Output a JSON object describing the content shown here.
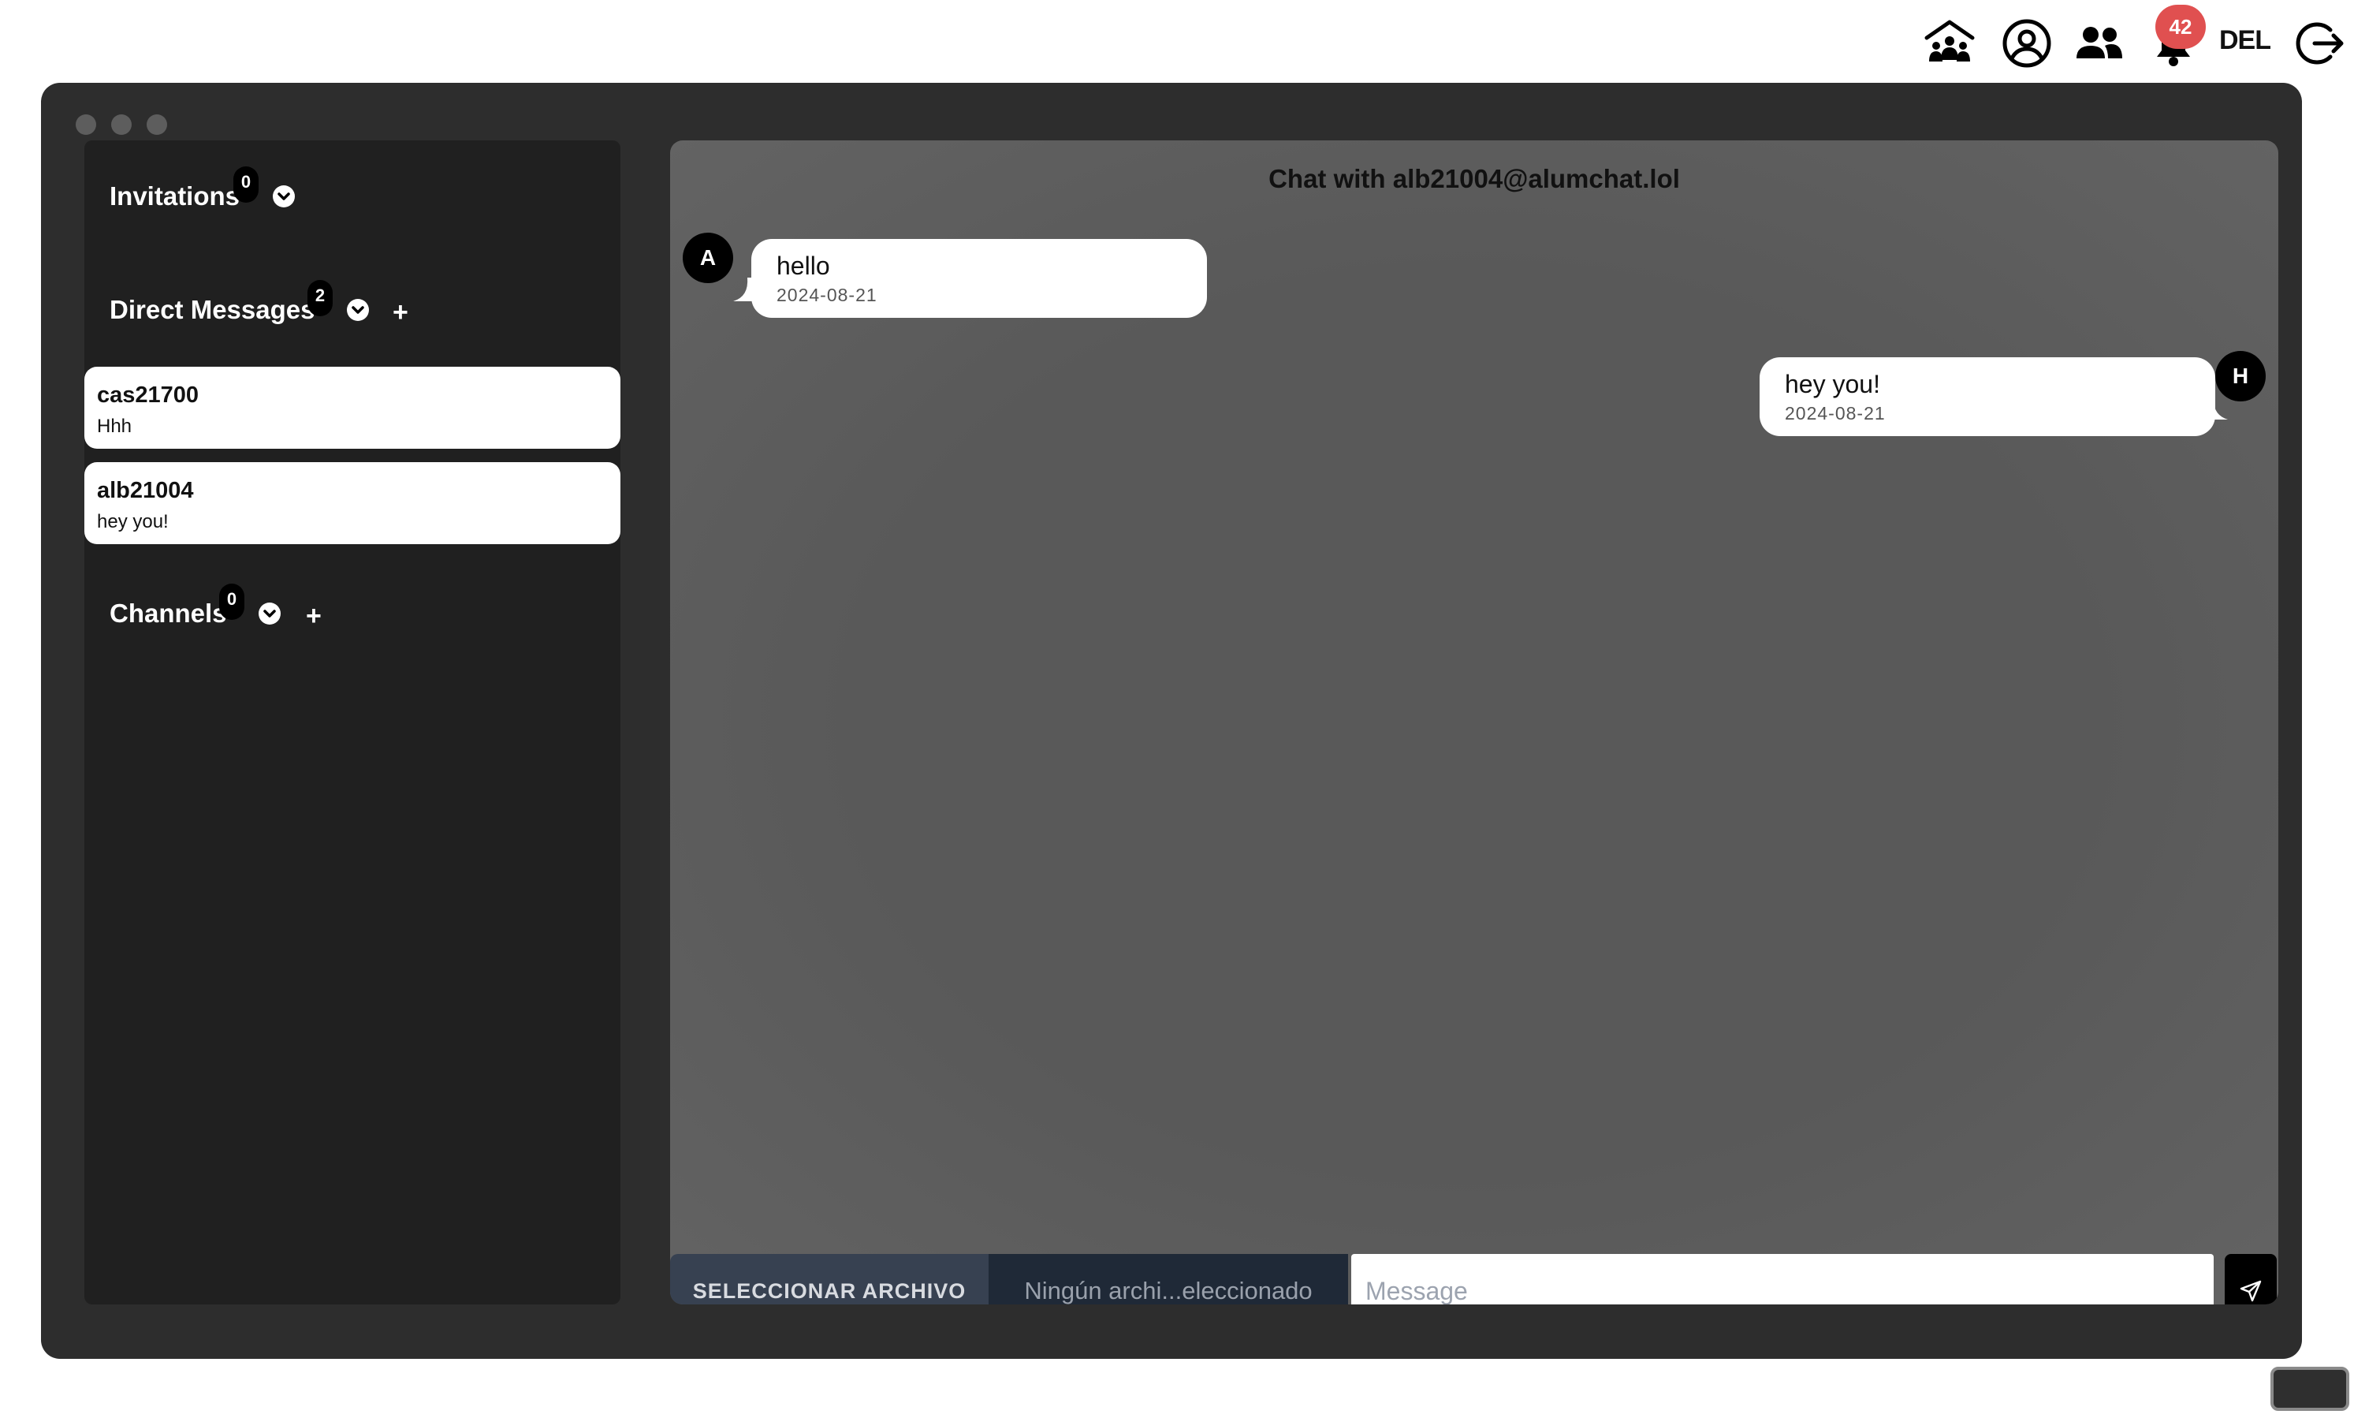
{
  "nav": {
    "icons": [
      "community-icon",
      "user-circle-icon",
      "users-icon",
      "bell-icon",
      "logout-icon"
    ],
    "notification_count": "42",
    "del_label": "DEL"
  },
  "sidebar": {
    "invitations": {
      "title": "Invitations",
      "count": "0"
    },
    "direct_messages": {
      "title": "Direct Messages",
      "count": "2",
      "items": [
        {
          "name": "cas21700",
          "preview": "Hhh"
        },
        {
          "name": "alb21004",
          "preview": "hey you!"
        }
      ]
    },
    "channels": {
      "title": "Channels",
      "count": "0"
    }
  },
  "chat": {
    "title": "Chat with alb21004@alumchat.lol",
    "messages": [
      {
        "avatar": "A",
        "text": "hello",
        "date": "2024-08-21",
        "side": "left"
      },
      {
        "avatar": "H",
        "text": "hey you!",
        "date": "2024-08-21",
        "side": "right"
      }
    ]
  },
  "composer": {
    "file_button": "SELECCIONAR ARCHIVO",
    "file_name": "Ningún archi...eleccionado",
    "placeholder": "Message"
  },
  "colors": {
    "window_bg": "#2d2d2d",
    "sidebar_bg": "#202020",
    "chat_bg": "#595959",
    "badge_red": "#e05050"
  }
}
